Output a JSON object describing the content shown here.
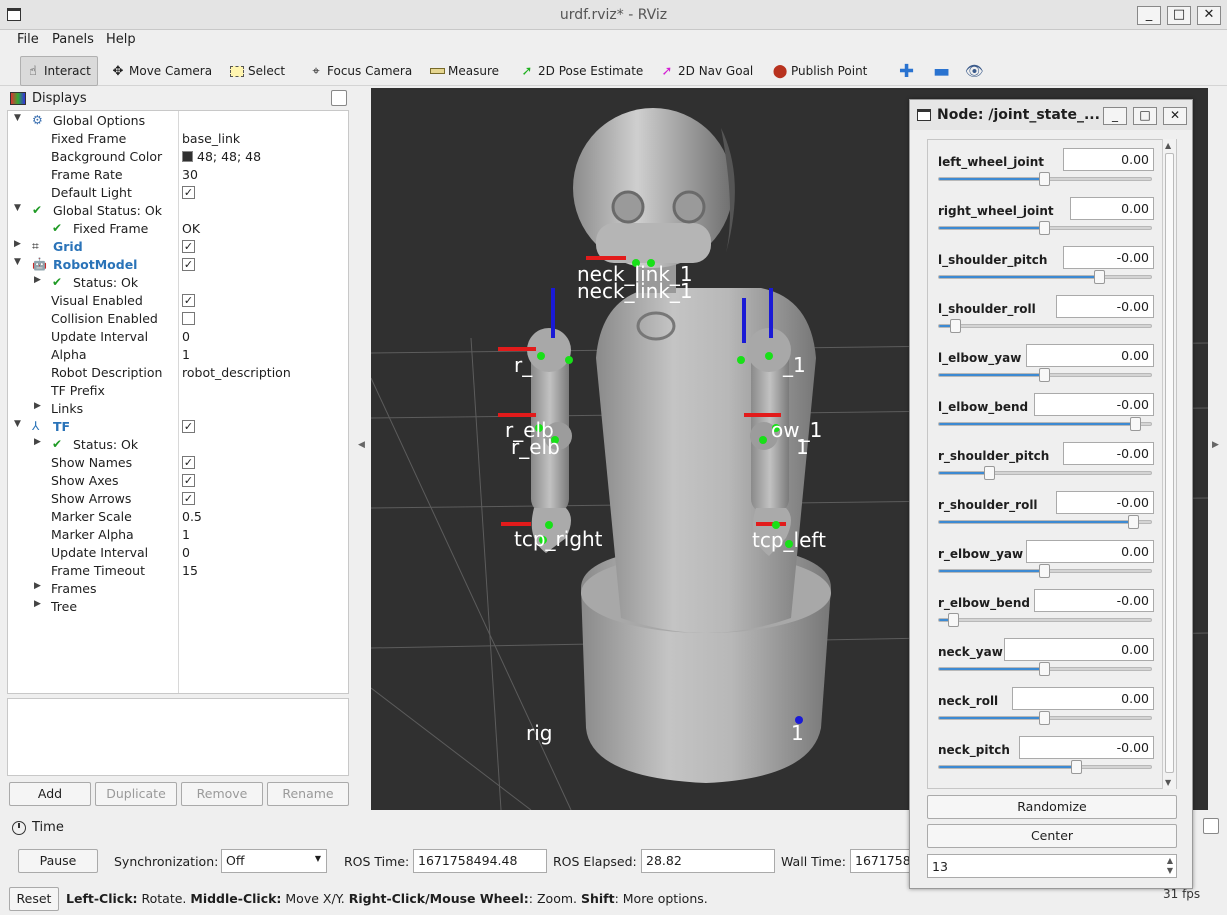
{
  "window": {
    "title": "urdf.rviz* - RViz"
  },
  "menu": [
    "File",
    "Panels",
    "Help"
  ],
  "toolbar": {
    "tools": [
      {
        "label": "Interact",
        "icon": "hand-pointer-icon"
      },
      {
        "label": "Move Camera",
        "icon": "move-arrows-icon"
      },
      {
        "label": "Select",
        "icon": "select-box-icon"
      },
      {
        "label": "Focus Camera",
        "icon": "crosshair-icon"
      },
      {
        "label": "Measure",
        "icon": "ruler-icon"
      },
      {
        "label": "2D Pose Estimate",
        "icon": "green-arrow-icon"
      },
      {
        "label": "2D Nav Goal",
        "icon": "magenta-arrow-icon"
      },
      {
        "label": "Publish Point",
        "icon": "map-pin-icon"
      }
    ]
  },
  "displays": {
    "title": "Displays",
    "rows": [
      {
        "name": "Global Options",
        "val": ""
      },
      {
        "name": "Fixed Frame",
        "val": "base_link"
      },
      {
        "name": "Background Color",
        "val": "48; 48; 48"
      },
      {
        "name": "Frame Rate",
        "val": "30"
      },
      {
        "name": "Default Light",
        "val": ""
      },
      {
        "name": "Global Status: Ok",
        "val": ""
      },
      {
        "name": "Fixed Frame",
        "val": "OK"
      },
      {
        "name": "Grid",
        "val": ""
      },
      {
        "name": "RobotModel",
        "val": ""
      },
      {
        "name": "Status: Ok",
        "val": ""
      },
      {
        "name": "Visual Enabled",
        "val": ""
      },
      {
        "name": "Collision Enabled",
        "val": ""
      },
      {
        "name": "Update Interval",
        "val": "0"
      },
      {
        "name": "Alpha",
        "val": "1"
      },
      {
        "name": "Robot Description",
        "val": "robot_description"
      },
      {
        "name": "TF Prefix",
        "val": ""
      },
      {
        "name": "Links",
        "val": ""
      },
      {
        "name": "TF",
        "val": ""
      },
      {
        "name": "Status: Ok",
        "val": ""
      },
      {
        "name": "Show Names",
        "val": ""
      },
      {
        "name": "Show Axes",
        "val": ""
      },
      {
        "name": "Show Arrows",
        "val": ""
      },
      {
        "name": "Marker Scale",
        "val": "0.5"
      },
      {
        "name": "Marker Alpha",
        "val": "1"
      },
      {
        "name": "Update Interval",
        "val": "0"
      },
      {
        "name": "Frame Timeout",
        "val": "15"
      },
      {
        "name": "Frames",
        "val": ""
      },
      {
        "name": "Tree",
        "val": ""
      }
    ],
    "buttons": {
      "add": "Add",
      "duplicate": "Duplicate",
      "remove": "Remove",
      "rename": "Rename"
    }
  },
  "viewport": {
    "background_color": "#303030",
    "labels": [
      "neck_link_1",
      "neck_link_1",
      "r_",
      "_1",
      "r_elb",
      "r_elb",
      "ow_1",
      "1",
      "tcp_right",
      "tcp_left",
      "rig",
      "1"
    ]
  },
  "time": {
    "title": "Time",
    "pause": "Pause",
    "sync_label": "Synchronization:",
    "sync_value": "Off",
    "ros_time_label": "ROS Time:",
    "ros_time": "1671758494.48",
    "ros_elapsed_label": "ROS Elapsed:",
    "ros_elapsed": "28.82",
    "wall_time_label": "Wall Time:",
    "wall_time": "1671758"
  },
  "status": {
    "reset": "Reset",
    "left": "Left-Click:",
    "left_desc": " Rotate. ",
    "middle": "Middle-Click:",
    "middle_desc": " Move X/Y. ",
    "right": "Right-Click/Mouse Wheel:",
    "right_desc": ": Zoom. ",
    "shift": "Shift",
    "shift_desc": ": More options.",
    "fps": "31 fps"
  },
  "joint_panel": {
    "title": "Node: /joint_state_...",
    "joints": [
      {
        "name": "left_wheel_joint",
        "value": "0.00",
        "pos": 0.5
      },
      {
        "name": "right_wheel_joint",
        "value": "0.00",
        "pos": 0.5
      },
      {
        "name": "l_shoulder_pitch",
        "value": "-0.00",
        "pos": 0.76
      },
      {
        "name": "l_shoulder_roll",
        "value": "-0.00",
        "pos": 0.08
      },
      {
        "name": "l_elbow_yaw",
        "value": "0.00",
        "pos": 0.5
      },
      {
        "name": "l_elbow_bend",
        "value": "-0.00",
        "pos": 0.93
      },
      {
        "name": "r_shoulder_pitch",
        "value": "-0.00",
        "pos": 0.24
      },
      {
        "name": "r_shoulder_roll",
        "value": "-0.00",
        "pos": 0.92
      },
      {
        "name": "r_elbow_yaw",
        "value": "0.00",
        "pos": 0.5
      },
      {
        "name": "r_elbow_bend",
        "value": "-0.00",
        "pos": 0.07
      },
      {
        "name": "neck_yaw",
        "value": "0.00",
        "pos": 0.5
      },
      {
        "name": "neck_roll",
        "value": "0.00",
        "pos": 0.5
      },
      {
        "name": "neck_pitch",
        "value": "-0.00",
        "pos": 0.65
      }
    ],
    "randomize": "Randomize",
    "center": "Center",
    "count": "13"
  }
}
